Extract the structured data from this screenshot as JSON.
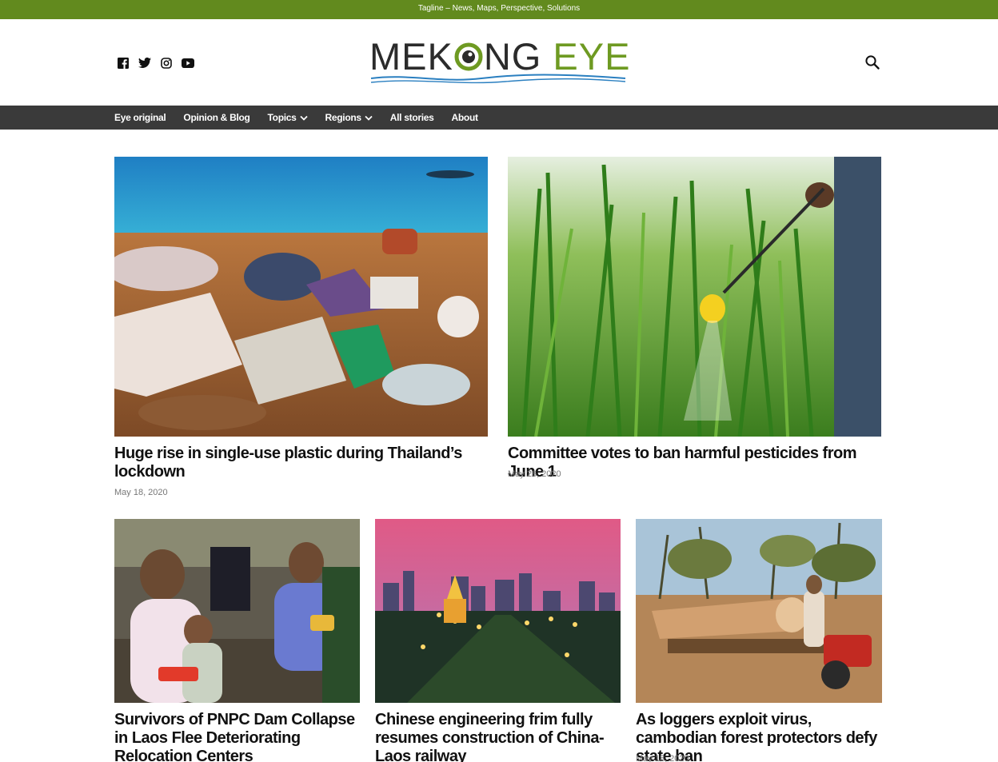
{
  "tagline": "Tagline – News, Maps, Perspective, Solutions",
  "logo": {
    "part1": "MEK",
    "part2": "NG",
    "part3": " EYE"
  },
  "social": [
    "facebook-icon",
    "twitter-icon",
    "instagram-icon",
    "youtube-icon"
  ],
  "nav": {
    "items": [
      {
        "label": "Eye original"
      },
      {
        "label": "Opinion & Blog"
      },
      {
        "label": "Topics"
      },
      {
        "label": "Regions"
      },
      {
        "label": "All stories"
      },
      {
        "label": "About"
      }
    ]
  },
  "colors": {
    "brand_green": "#628a1e",
    "nav_dark": "#3a3a3a"
  },
  "stories": [
    {
      "title": "Huge rise in single-use plastic during Thailand’s lockdown",
      "date": "May 18, 2020"
    },
    {
      "title": "Committee votes to ban harmful pesticides from June 1",
      "date": "May 26, 2020"
    },
    {
      "title": "Survivors of PNPC Dam Collapse in Laos Flee Deteriorating Relocation Centers",
      "date": ""
    },
    {
      "title": "Chinese engineering frim fully resumes construction of China-Laos railway",
      "date": ""
    },
    {
      "title": "As loggers exploit virus, cambodian forest protectors defy state ban",
      "date": "May 18, 2020"
    }
  ]
}
